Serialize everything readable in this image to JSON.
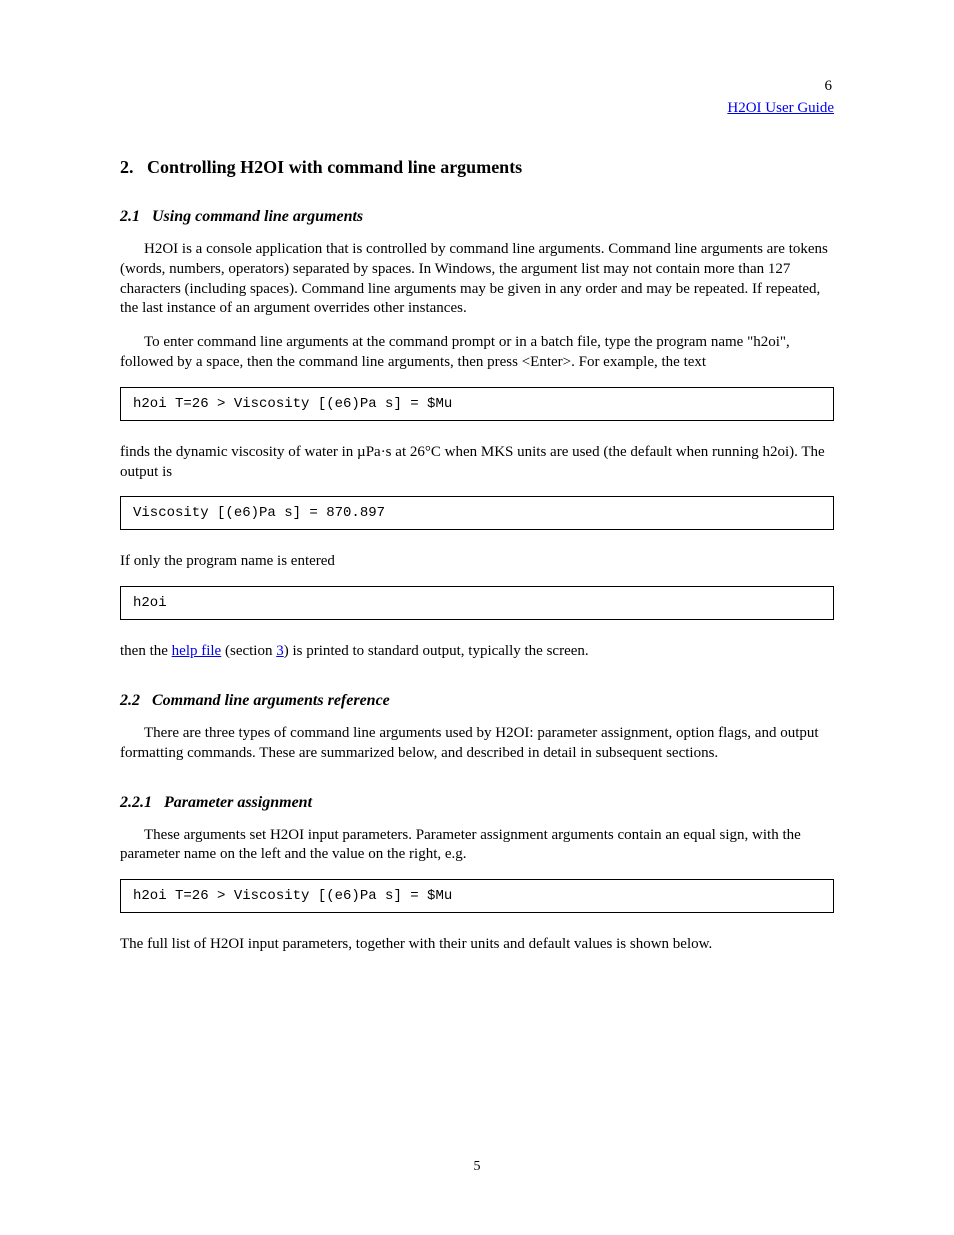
{
  "pageTop": "6",
  "xrefTop": "H2OI User Guide",
  "section": {
    "number": "2.",
    "title": "Controlling H2OI with command line arguments"
  },
  "sub21": {
    "number": "2.1",
    "title": "Using command line arguments",
    "p1": "H2OI is a console application that is controlled by command line arguments. Command line arguments are tokens (words, numbers, operators) separated by spaces. In Windows, the argument list may not contain more than 127 characters (including spaces). Command line arguments may be given in any order and may be repeated. If repeated, the last instance of an argument overrides other instances.",
    "p2": "To enter command line arguments at the command prompt or in a batch file, type the program name \"h2oi\", followed by a space, then the command line arguments, then press <Enter>. For example, the text",
    "code": "h2oi T=26 > Viscosity [(e6)Pa s] = $Mu",
    "p3a": "finds the dynamic viscosity of water in ",
    "p3b": " at 26°C when MKS units are used (the default when running h2oi). The output is"
  },
  "unit": "µPa·s",
  "output1": "Viscosity [(e6)Pa s] = 870.897",
  "p4": "If only the program name is entered",
  "code_h2oi": "h2oi",
  "p5a": "then the ",
  "p5b": " (section ",
  "sec3": "3",
  "p5c": ") is printed to standard output, typically the screen.",
  "helpfile_link": "help file",
  "sub22": {
    "number": "2.2",
    "title": "Command line arguments reference",
    "p1": "There are three types of command line arguments used by H2OI: parameter assignment, option flags, and output formatting commands. These are summarized below, and described in detail in subsequent sections."
  },
  "sub221": {
    "number": "2.2.1",
    "title": "Parameter assignment",
    "p1": "These arguments set H2OI input parameters. Parameter assignment arguments contain an equal sign, with the parameter name on the left and the value on the right, e.g.",
    "code": "h2oi T=26 > Viscosity [(e6)Pa s] = $Mu",
    "p2": "The full list of H2OI input parameters, together with their units and default values is shown below."
  },
  "footerPage": "5"
}
